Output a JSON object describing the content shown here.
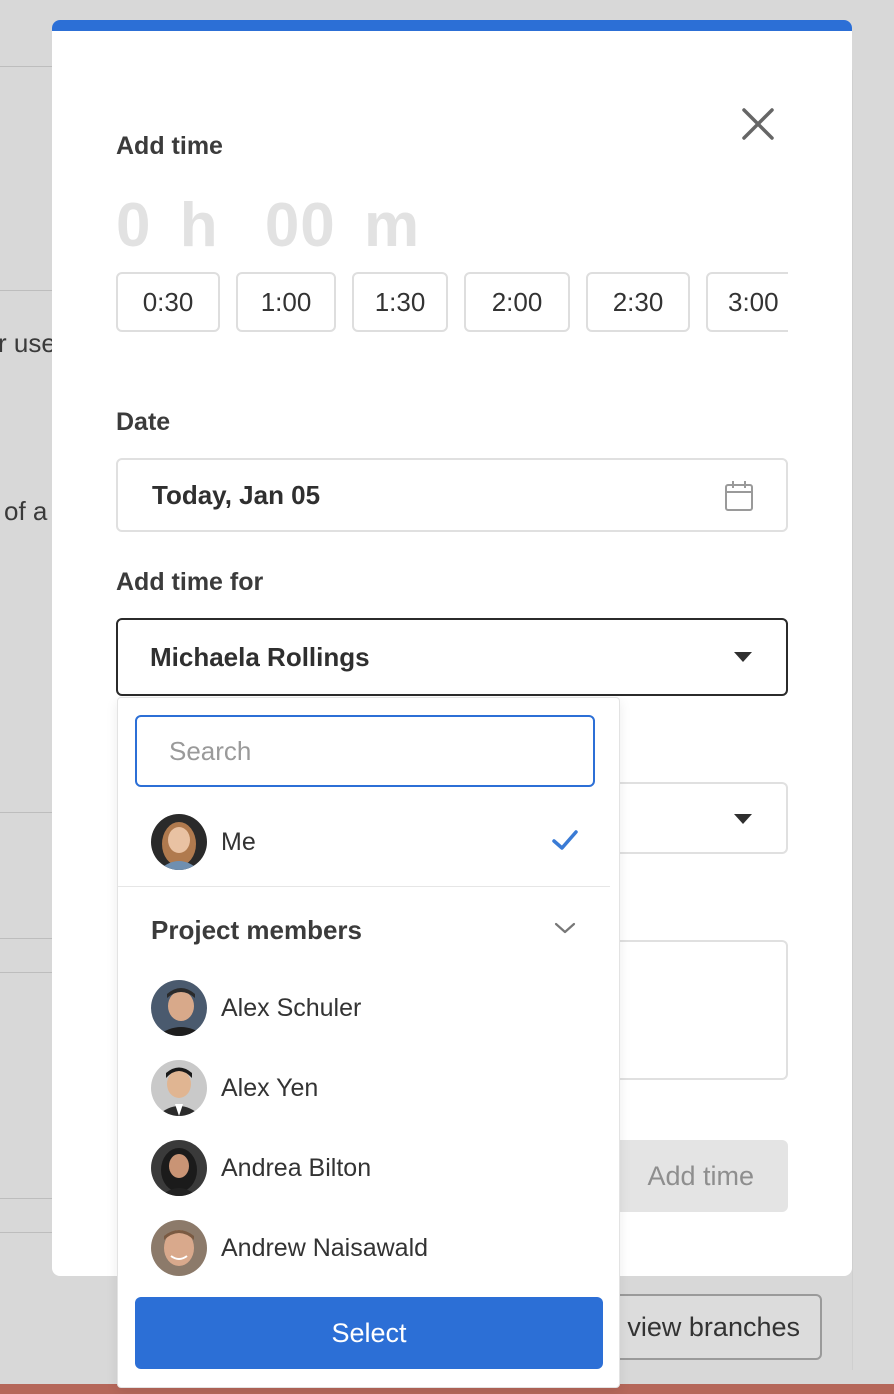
{
  "background": {
    "fragments": [
      "r use",
      "of a"
    ],
    "view_branches_label": "view branches"
  },
  "modal": {
    "add_time_label": "Add time",
    "hours_value": "0",
    "hours_unit": "h",
    "minutes_value": "00",
    "minutes_unit": "m",
    "presets": [
      "0:30",
      "1:00",
      "1:30",
      "2:00",
      "2:30",
      "3:00"
    ],
    "date_label": "Date",
    "date_value": "Today, Jan 05",
    "add_time_for_label": "Add time for",
    "selected_person": "Michaela Rollings",
    "add_time_button": "Add time"
  },
  "dropdown": {
    "search_placeholder": "Search",
    "me_label": "Me",
    "me_selected": true,
    "group_title": "Project members",
    "members": [
      "Alex Schuler",
      "Alex Yen",
      "Andrea Bilton",
      "Andrew Naisawald"
    ],
    "select_button": "Select"
  },
  "colors": {
    "accent": "#2c6fd6",
    "check": "#3a7bd5",
    "backdrop": "#d8d8d8"
  },
  "icons": [
    "close-icon",
    "calendar-icon",
    "caret-down-icon",
    "check-icon",
    "chevron-down-icon"
  ]
}
